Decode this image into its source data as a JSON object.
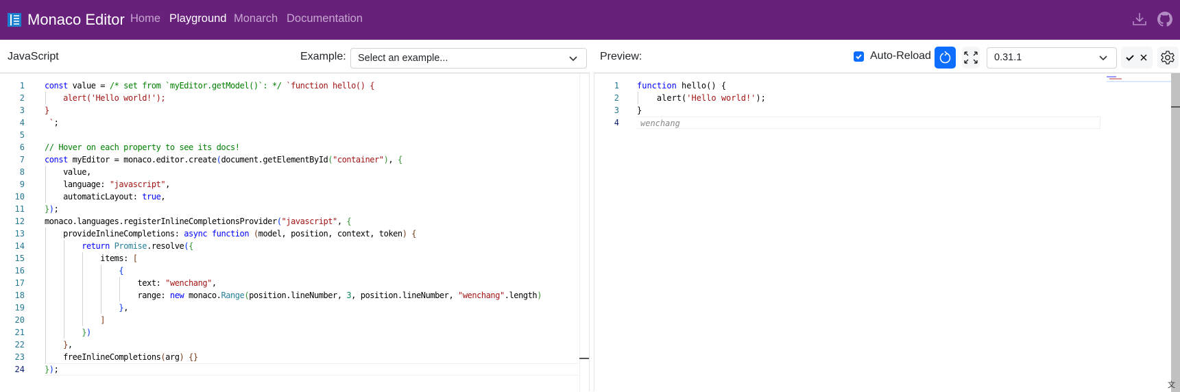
{
  "header": {
    "brand": "Monaco Editor",
    "nav": [
      "Home",
      "Playground",
      "Monarch",
      "Documentation"
    ],
    "active": "Playground",
    "icons": [
      "download-icon",
      "github-icon"
    ],
    "color": "#68217a"
  },
  "toolbar": {
    "language": "JavaScript",
    "example_label": "Example:",
    "example_placeholder": "Select an example...",
    "preview_label": "Preview:",
    "auto_reload_label": "Auto-Reload",
    "auto_reload_checked": true,
    "version": "0.31.1",
    "accent": "#0d6efd"
  },
  "left_editor": {
    "current_line": 24,
    "lines": [
      [
        [
          "const",
          "k"
        ],
        [
          " value = ",
          ""
        ],
        [
          "/* set from `myEditor.getModel()`: */",
          "c"
        ],
        [
          " ",
          ""
        ],
        [
          "`function hello() {",
          "s"
        ]
      ],
      [
        [
          "    alert('Hello world!');",
          "s"
        ]
      ],
      [
        [
          "}",
          "s"
        ]
      ],
      [
        [
          " `",
          "s"
        ],
        [
          ";",
          ""
        ]
      ],
      [],
      [
        [
          "// Hover on each property to see its docs!",
          "c"
        ]
      ],
      [
        [
          "const",
          "k"
        ],
        [
          " myEditor = monaco.editor.create",
          ""
        ],
        [
          "(",
          "b1"
        ],
        [
          "document.getElementById",
          ""
        ],
        [
          "(",
          "b2"
        ],
        [
          "\"container\"",
          "s"
        ],
        [
          ")",
          "b2"
        ],
        [
          ", ",
          ""
        ],
        [
          "{",
          "b2"
        ]
      ],
      [
        [
          "    value,",
          ""
        ]
      ],
      [
        [
          "    language: ",
          ""
        ],
        [
          "\"javascript\"",
          "s"
        ],
        [
          ",",
          ""
        ]
      ],
      [
        [
          "    automaticLayout: ",
          ""
        ],
        [
          "true",
          "k"
        ],
        [
          ",",
          ""
        ]
      ],
      [
        [
          "}",
          "b2"
        ],
        [
          ")",
          "b1"
        ],
        [
          ";",
          ""
        ]
      ],
      [
        [
          "monaco.languages.registerInlineCompletionsProvider",
          ""
        ],
        [
          "(",
          "b1"
        ],
        [
          "\"javascript\"",
          "s"
        ],
        [
          ", ",
          ""
        ],
        [
          "{",
          "b2"
        ]
      ],
      [
        [
          "    provideInlineCompletions: ",
          ""
        ],
        [
          "async",
          "k"
        ],
        [
          " ",
          ""
        ],
        [
          "function",
          "k"
        ],
        [
          " ",
          ""
        ],
        [
          "(",
          "b3"
        ],
        [
          "model, position, context, token",
          ""
        ],
        [
          ")",
          "b3"
        ],
        [
          " ",
          ""
        ],
        [
          "{",
          "b3"
        ]
      ],
      [
        [
          "        ",
          ""
        ],
        [
          "return",
          "k"
        ],
        [
          " ",
          ""
        ],
        [
          "Promise",
          "t"
        ],
        [
          ".resolve",
          ""
        ],
        [
          "(",
          "b1"
        ],
        [
          "{",
          "b2"
        ]
      ],
      [
        [
          "            items: ",
          ""
        ],
        [
          "[",
          "b3"
        ]
      ],
      [
        [
          "                ",
          ""
        ],
        [
          "{",
          "b1"
        ]
      ],
      [
        [
          "                    text: ",
          ""
        ],
        [
          "\"wenchang\"",
          "s"
        ],
        [
          ",",
          ""
        ]
      ],
      [
        [
          "                    range: ",
          ""
        ],
        [
          "new",
          "k"
        ],
        [
          " monaco.",
          ""
        ],
        [
          "Range",
          "t"
        ],
        [
          "(",
          "b2"
        ],
        [
          "position.lineNumber, ",
          ""
        ],
        [
          "3",
          "n"
        ],
        [
          ", position.lineNumber, ",
          ""
        ],
        [
          "\"wenchang\"",
          "s"
        ],
        [
          ".length",
          ""
        ],
        [
          ")",
          "b2"
        ]
      ],
      [
        [
          "                ",
          ""
        ],
        [
          "}",
          "b1"
        ],
        [
          ",",
          ""
        ]
      ],
      [
        [
          "            ",
          ""
        ],
        [
          "]",
          "b3"
        ]
      ],
      [
        [
          "        ",
          ""
        ],
        [
          "}",
          "b2"
        ],
        [
          ")",
          "b1"
        ]
      ],
      [
        [
          "    ",
          ""
        ],
        [
          "}",
          "b3"
        ],
        [
          ",",
          ""
        ]
      ],
      [
        [
          "    freeInlineCompletions",
          ""
        ],
        [
          "(",
          "b3"
        ],
        [
          "arg",
          ""
        ],
        [
          ")",
          "b3"
        ],
        [
          " ",
          ""
        ],
        [
          "{}",
          "b3"
        ]
      ],
      [
        [
          "}",
          "b2"
        ],
        [
          ")",
          "b1"
        ],
        [
          ";",
          ""
        ]
      ]
    ]
  },
  "preview_editor": {
    "current_line": 4,
    "lines": [
      [
        [
          "function",
          "k"
        ],
        [
          " hello() {",
          ""
        ]
      ],
      [
        [
          "    alert(",
          ""
        ],
        [
          "'Hello world!'",
          "s"
        ],
        [
          ");",
          ""
        ]
      ],
      [
        [
          "}",
          ""
        ]
      ]
    ],
    "ghost_text": "wenchang"
  }
}
